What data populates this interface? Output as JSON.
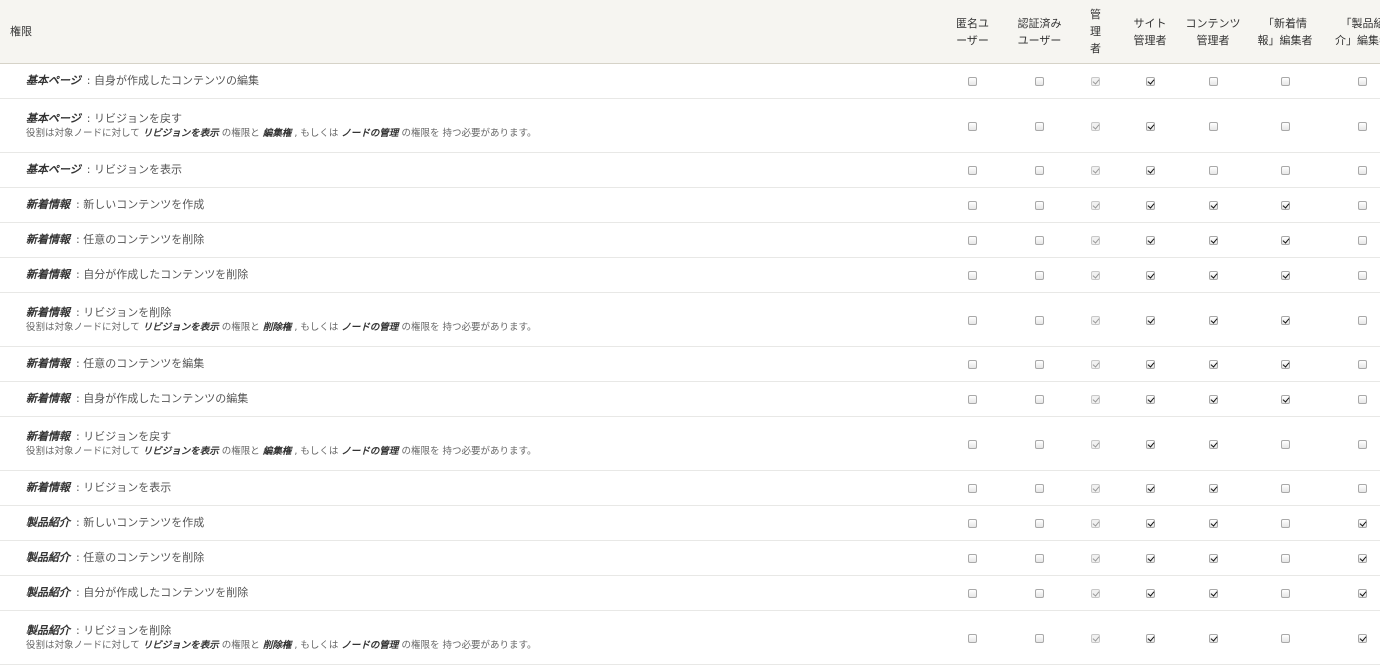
{
  "header": {
    "permission_label": "権限",
    "roles": [
      {
        "label": "匿名ユ\nーザー"
      },
      {
        "label": "認証済み\nユーザー"
      },
      {
        "label": "管\n理\n者"
      },
      {
        "label": "サイト\n管理者"
      },
      {
        "label": "コンテンツ\n管理者"
      },
      {
        "label": "「新着情\n報」編集者"
      },
      {
        "label": "「製品紹\n介」編集者"
      }
    ]
  },
  "rows": [
    {
      "type": "基本ページ",
      "text": ": 自身が作成したコンテンツの編集",
      "checks": [
        0,
        0,
        2,
        1,
        0,
        0,
        0
      ]
    },
    {
      "type": "基本ページ",
      "text": ": リビジョンを戻す",
      "note": {
        "pre": "役割は対象ノードに対して ",
        "b1": "リビジョンを表示",
        "mid1": " の権限と ",
        "b2": "編集権",
        "mid2": " , もしくは ",
        "b3": "ノードの管理",
        "post": " の権限を 持つ必要があります。"
      },
      "checks": [
        0,
        0,
        2,
        1,
        0,
        0,
        0
      ]
    },
    {
      "type": "基本ページ",
      "text": ": リビジョンを表示",
      "checks": [
        0,
        0,
        2,
        1,
        0,
        0,
        0
      ]
    },
    {
      "type": "新着情報",
      "text": ": 新しいコンテンツを作成",
      "checks": [
        0,
        0,
        2,
        1,
        1,
        1,
        0
      ]
    },
    {
      "type": "新着情報",
      "text": ": 任意のコンテンツを削除",
      "checks": [
        0,
        0,
        2,
        1,
        1,
        1,
        0
      ]
    },
    {
      "type": "新着情報",
      "text": ": 自分が作成したコンテンツを削除",
      "checks": [
        0,
        0,
        2,
        1,
        1,
        1,
        0
      ]
    },
    {
      "type": "新着情報",
      "text": ": リビジョンを削除",
      "note": {
        "pre": "役割は対象ノードに対して ",
        "b1": "リビジョンを表示",
        "mid1": " の権限と ",
        "b2": "削除権",
        "mid2": " , もしくは ",
        "b3": "ノードの管理",
        "post": " の権限を 持つ必要があります。"
      },
      "checks": [
        0,
        0,
        2,
        1,
        1,
        1,
        0
      ]
    },
    {
      "type": "新着情報",
      "text": ": 任意のコンテンツを編集",
      "checks": [
        0,
        0,
        2,
        1,
        1,
        1,
        0
      ]
    },
    {
      "type": "新着情報",
      "text": ": 自身が作成したコンテンツの編集",
      "checks": [
        0,
        0,
        2,
        1,
        1,
        1,
        0
      ]
    },
    {
      "type": "新着情報",
      "text": ": リビジョンを戻す",
      "note": {
        "pre": "役割は対象ノードに対して ",
        "b1": "リビジョンを表示",
        "mid1": " の権限と ",
        "b2": "編集権",
        "mid2": " , もしくは ",
        "b3": "ノードの管理",
        "post": " の権限を 持つ必要があります。"
      },
      "checks": [
        0,
        0,
        2,
        1,
        1,
        0,
        0
      ]
    },
    {
      "type": "新着情報",
      "text": ": リビジョンを表示",
      "checks": [
        0,
        0,
        2,
        1,
        1,
        0,
        0
      ]
    },
    {
      "type": "製品紹介",
      "text": ": 新しいコンテンツを作成",
      "checks": [
        0,
        0,
        2,
        1,
        1,
        0,
        1
      ]
    },
    {
      "type": "製品紹介",
      "text": ": 任意のコンテンツを削除",
      "checks": [
        0,
        0,
        2,
        1,
        1,
        0,
        1
      ]
    },
    {
      "type": "製品紹介",
      "text": ": 自分が作成したコンテンツを削除",
      "checks": [
        0,
        0,
        2,
        1,
        1,
        0,
        1
      ]
    },
    {
      "type": "製品紹介",
      "text": ": リビジョンを削除",
      "note": {
        "pre": "役割は対象ノードに対して ",
        "b1": "リビジョンを表示",
        "mid1": " の権限と ",
        "b2": "削除権",
        "mid2": " , もしくは ",
        "b3": "ノードの管理",
        "post": " の権限を 持つ必要があります。"
      },
      "checks": [
        0,
        0,
        2,
        1,
        1,
        0,
        1
      ]
    }
  ]
}
